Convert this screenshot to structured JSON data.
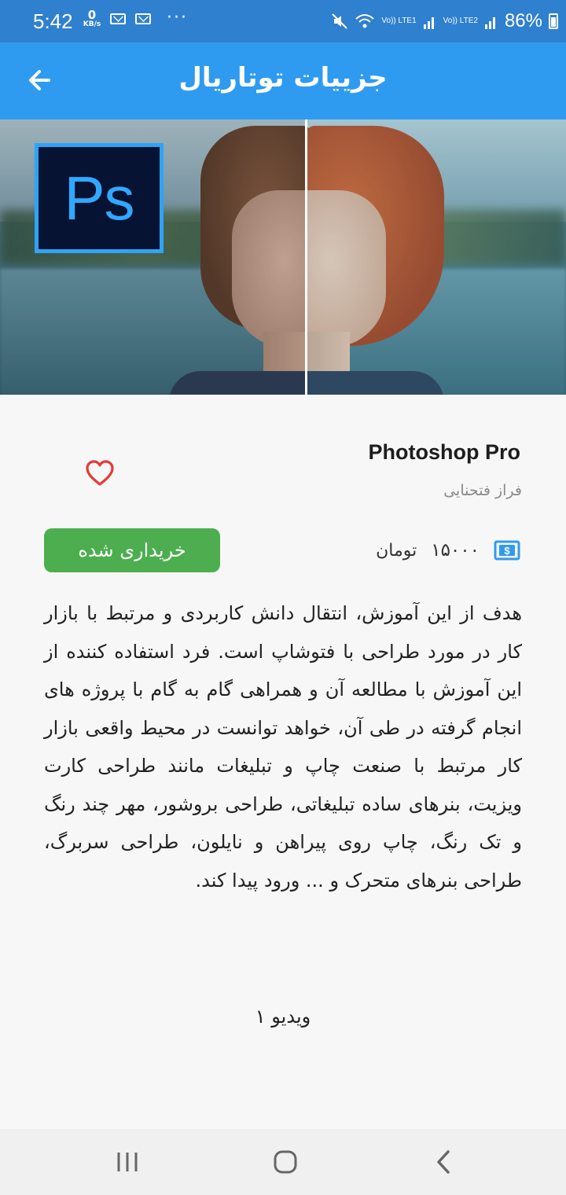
{
  "status_bar": {
    "time": "5:42",
    "net_speed_value": "0",
    "net_speed_unit": "KB/s",
    "overflow": "···",
    "sim1_label": "Vo)) LTE1",
    "sim2_label": "Vo)) LTE2",
    "battery": "86%",
    "icons": [
      "mail-icon",
      "mail-icon",
      "mute-icon",
      "wifi-icon",
      "signal-icon",
      "battery-icon"
    ]
  },
  "app_bar": {
    "title": "جزییات توتاریال",
    "back_icon": "arrow-left-icon"
  },
  "hero": {
    "logo_text": "Ps"
  },
  "course": {
    "title": "Photoshop Pro",
    "instructor": "فراز فتحنایی",
    "favorite_icon": "heart-outline-icon",
    "price_icon": "dollar-icon",
    "price_value": "۱۵۰۰۰",
    "price_currency": "تومان",
    "purchased_label": "خریداری شده",
    "description": "هدف از این آموزش، انتقال دانش کاربردی و مرتبط با بازار کار در مورد طراحی با فتوشاپ است. فرد استفاده کننده از این آموزش با مطالعه آن و همراهی گام به گام با پروژه های انجام گرفته در طی آن، خواهد توانست در محیط واقعی بازار کار مرتبط با صنعت چاپ و تبلیغات مانند طراحی کارت ویزیت، بنرهای ساده تبلیغاتی، طراحی بروشور، مهر چند رنگ و تک رنگ، چاپ روی پیراهن و نایلون، طراحی سربرگ، طراحی بنرهای متحرک و ... ورود پیدا کند."
  },
  "videos": [
    {
      "label": "ویدیو ۱"
    }
  ],
  "nav_bar": {
    "icons": [
      "recent-apps-icon",
      "home-icon",
      "back-icon"
    ]
  },
  "colors": {
    "status_bar": "#2f80cf",
    "app_bar": "#2f9bf0",
    "purchased_button": "#4cae4f",
    "favorite": "#e53935",
    "price_icon": "#2f9bf0"
  }
}
